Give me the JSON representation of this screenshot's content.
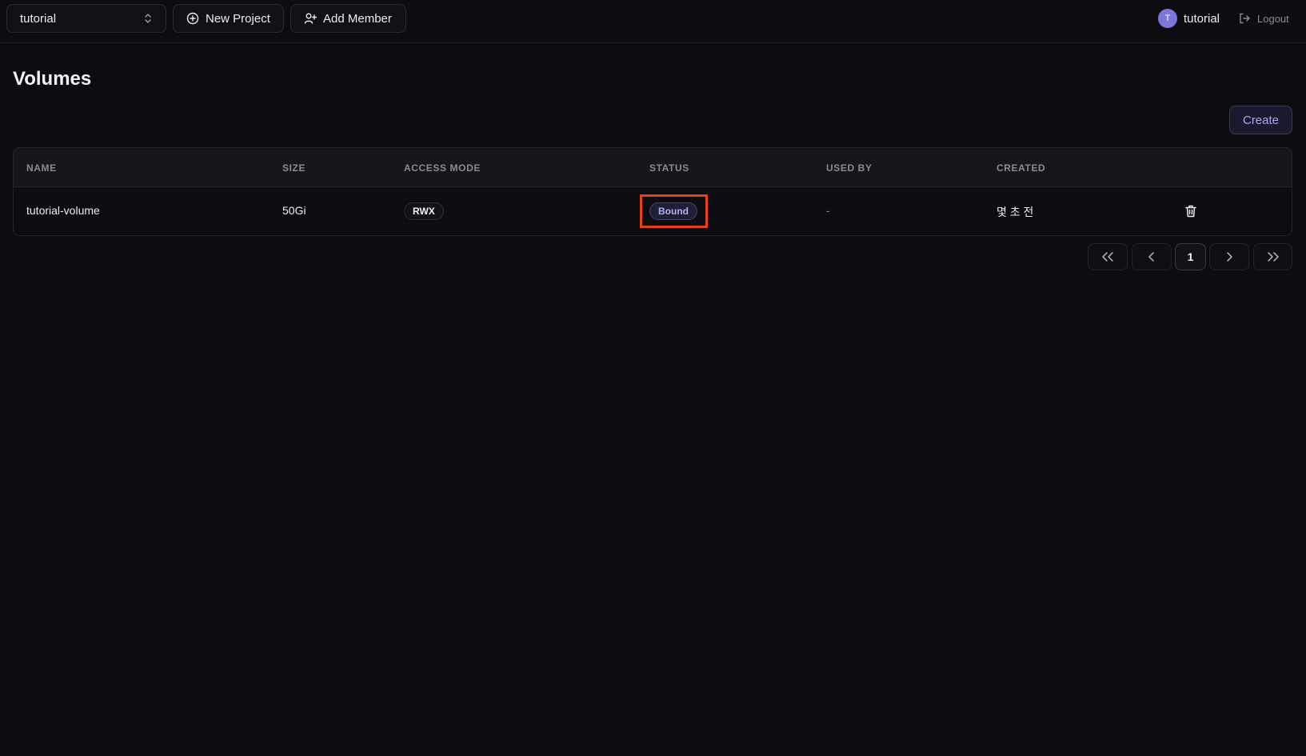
{
  "topbar": {
    "project_selector": {
      "value": "tutorial",
      "icon": "chevron-updown-icon"
    },
    "new_project_label": "New Project",
    "add_member_label": "Add Member",
    "user": {
      "avatar_initial": "T",
      "name": "tutorial",
      "avatar_color": "#7c77d9"
    },
    "logout_label": "Logout"
  },
  "page": {
    "title": "Volumes",
    "create_label": "Create"
  },
  "table": {
    "columns": [
      "NAME",
      "SIZE",
      "ACCESS MODE",
      "STATUS",
      "USED BY",
      "CREATED"
    ],
    "rows": [
      {
        "name": "tutorial-volume",
        "size": "50Gi",
        "access_mode": "RWX",
        "status": "Bound",
        "used_by": "-",
        "created": "몇 초 전"
      }
    ]
  },
  "pagination": {
    "current_page": "1"
  },
  "colors": {
    "background": "#0d0d11",
    "accent": "#aaa6f2",
    "highlight": "#e3421b"
  }
}
